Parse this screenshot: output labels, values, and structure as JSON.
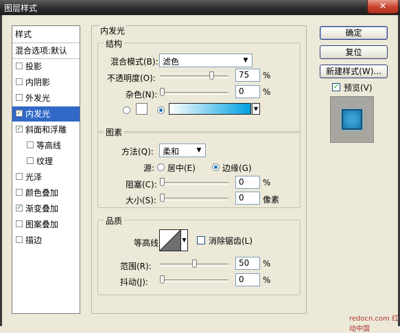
{
  "window": {
    "title": "图层样式",
    "close_label": "✕"
  },
  "left": {
    "header": "样式",
    "blend_defaults": "混合选项:默认",
    "items": [
      {
        "label": "投影",
        "checked": ""
      },
      {
        "label": "内阴影",
        "checked": ""
      },
      {
        "label": "外发光",
        "checked": ""
      },
      {
        "label": "内发光",
        "checked": "✓"
      },
      {
        "label": "斜面和浮雕",
        "checked": "✓"
      },
      {
        "label": "等高线",
        "checked": ""
      },
      {
        "label": "纹理",
        "checked": ""
      },
      {
        "label": "光泽",
        "checked": ""
      },
      {
        "label": "颜色叠加",
        "checked": ""
      },
      {
        "label": "渐变叠加",
        "checked": "✓"
      },
      {
        "label": "图案叠加",
        "checked": ""
      },
      {
        "label": "描边",
        "checked": ""
      }
    ]
  },
  "panel": {
    "title": "内发光",
    "structure": {
      "title": "结构",
      "blend_mode_label": "混合模式(B):",
      "blend_mode_value": "滤色",
      "opacity_label": "不透明度(O):",
      "opacity_value": "75",
      "opacity_unit": "%",
      "opacity_fraction": 0.75,
      "noise_label": "杂色(N):",
      "noise_value": "0",
      "noise_unit": "%"
    },
    "elements": {
      "title": "图素",
      "method_label": "方法(Q):",
      "method_value": "柔和",
      "source_label": "源:",
      "source_center": "居中(E)",
      "source_edge": "边缘(G)",
      "choke_label": "阻塞(C):",
      "choke_value": "0",
      "choke_unit": "%",
      "size_label": "大小(S):",
      "size_value": "0",
      "size_unit": "像素"
    },
    "quality": {
      "title": "品质",
      "contour_label": "等高线:",
      "antialias_label": "消除锯齿(L)",
      "range_label": "范围(R):",
      "range_value": "50",
      "range_unit": "%",
      "jitter_label": "抖动(J):",
      "jitter_value": "0",
      "jitter_unit": "%"
    }
  },
  "buttons": {
    "ok": "确定",
    "reset": "复位",
    "new_style": "新建样式(W)...",
    "preview_label": "预览(V)"
  },
  "colors": {
    "glow_gradient_start": "#ffffff",
    "glow_gradient_end": "#00a0e0",
    "selection": "#3169c6"
  },
  "watermark": "redocn.com 红动中国"
}
